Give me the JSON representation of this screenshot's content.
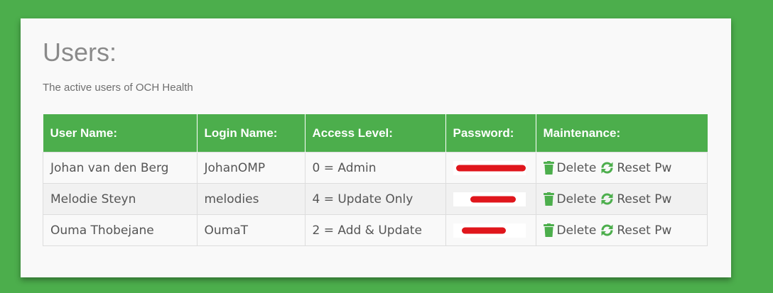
{
  "header": {
    "title": "Users:",
    "subtitle": "The active users of OCH Health"
  },
  "table": {
    "columns": [
      "User Name:",
      "Login Name:",
      "Access Level:",
      "Password:",
      "Maintenance:"
    ],
    "rows": [
      {
        "user_name": "Johan van den Berg",
        "login_name": "JohanOMP",
        "access_level": "0 = Admin",
        "password": "",
        "delete_label": "Delete",
        "reset_label": "Reset Pw"
      },
      {
        "user_name": "Melodie Steyn",
        "login_name": "melodies",
        "access_level": "4 = Update Only",
        "password": "",
        "delete_label": "Delete",
        "reset_label": "Reset Pw"
      },
      {
        "user_name": "Ouma Thobejane",
        "login_name": "OumaT",
        "access_level": "2 = Add & Update",
        "password": "",
        "delete_label": "Delete",
        "reset_label": "Reset Pw"
      }
    ]
  },
  "icons": {
    "delete": "trash-icon",
    "reset": "refresh-icon"
  },
  "colors": {
    "accent": "#4cae4c",
    "redaction": "#e0161c"
  }
}
